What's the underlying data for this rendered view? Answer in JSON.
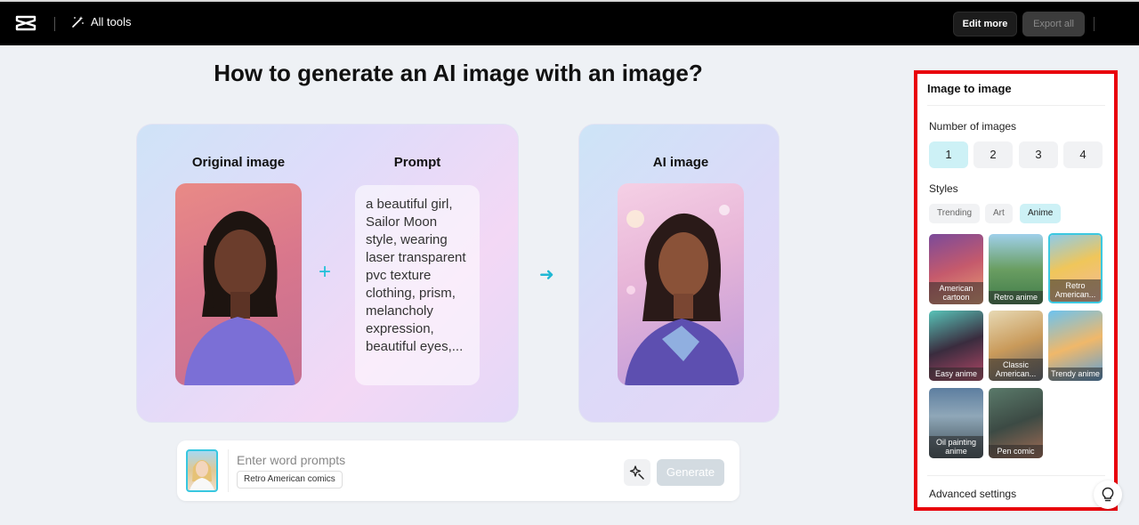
{
  "topbar": {
    "all_tools_label": "All tools",
    "edit_more_label": "Edit more",
    "export_all_label": "Export all"
  },
  "main": {
    "heading": "How to generate an AI image with an image?",
    "original_label": "Original image",
    "prompt_label": "Prompt",
    "prompt_text": "a beautiful girl, Sailor Moon style, wearing laser transparent pvc texture clothing, prism, melancholy expression, beautiful eyes,...",
    "ai_label": "AI image"
  },
  "input_bar": {
    "placeholder": "Enter word prompts",
    "style_chip": "Retro American comics",
    "generate_label": "Generate"
  },
  "panel": {
    "title": "Image to image",
    "number_label": "Number of images",
    "numbers": [
      "1",
      "2",
      "3",
      "4"
    ],
    "selected_number": "1",
    "styles_label": "Styles",
    "style_tabs": [
      "Trending",
      "Art",
      "Anime"
    ],
    "selected_tab": "Anime",
    "thumbnails": [
      {
        "label": "American cartoon"
      },
      {
        "label": "Retro anime"
      },
      {
        "label": "Retro American..."
      },
      {
        "label": "Easy anime"
      },
      {
        "label": "Classic American..."
      },
      {
        "label": "Trendy anime"
      },
      {
        "label": "Oil painting anime"
      },
      {
        "label": "Pen comic"
      }
    ],
    "advanced_label": "Advanced settings"
  },
  "colors": {
    "accent": "#1fc0d8",
    "highlight_border": "#e8000b",
    "selected_bg": "#cdf1f6"
  }
}
